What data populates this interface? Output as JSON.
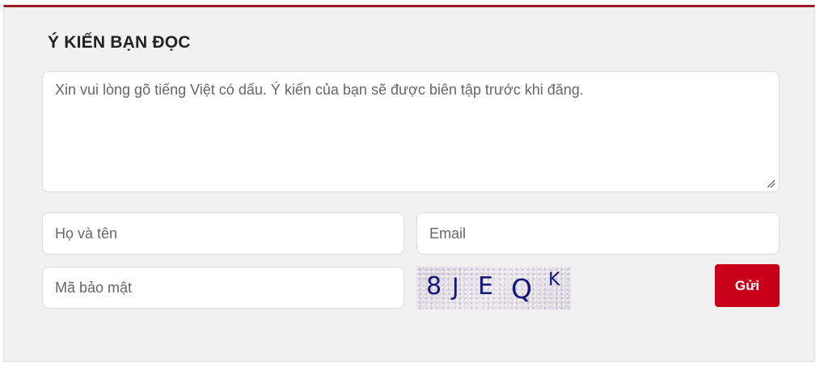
{
  "form": {
    "title": "Ý KIẾN BẠN ĐỌC",
    "comment_placeholder": "Xin vui lòng gõ tiếng Việt có dấu. Ý kiến của bạn sẽ được biên tập trước khi đăng.",
    "name_placeholder": "Họ và tên",
    "email_placeholder": "Email",
    "captcha_input_placeholder": "Mã bảo mật",
    "captcha_chars": [
      "8",
      "J",
      "E",
      "Q",
      "K"
    ],
    "submit_label": "Gửi"
  },
  "colors": {
    "accent_border": "#9e1b22",
    "submit_button": "#c8001a",
    "panel_background": "#f1f1f1",
    "captcha_text": "#14157a"
  }
}
